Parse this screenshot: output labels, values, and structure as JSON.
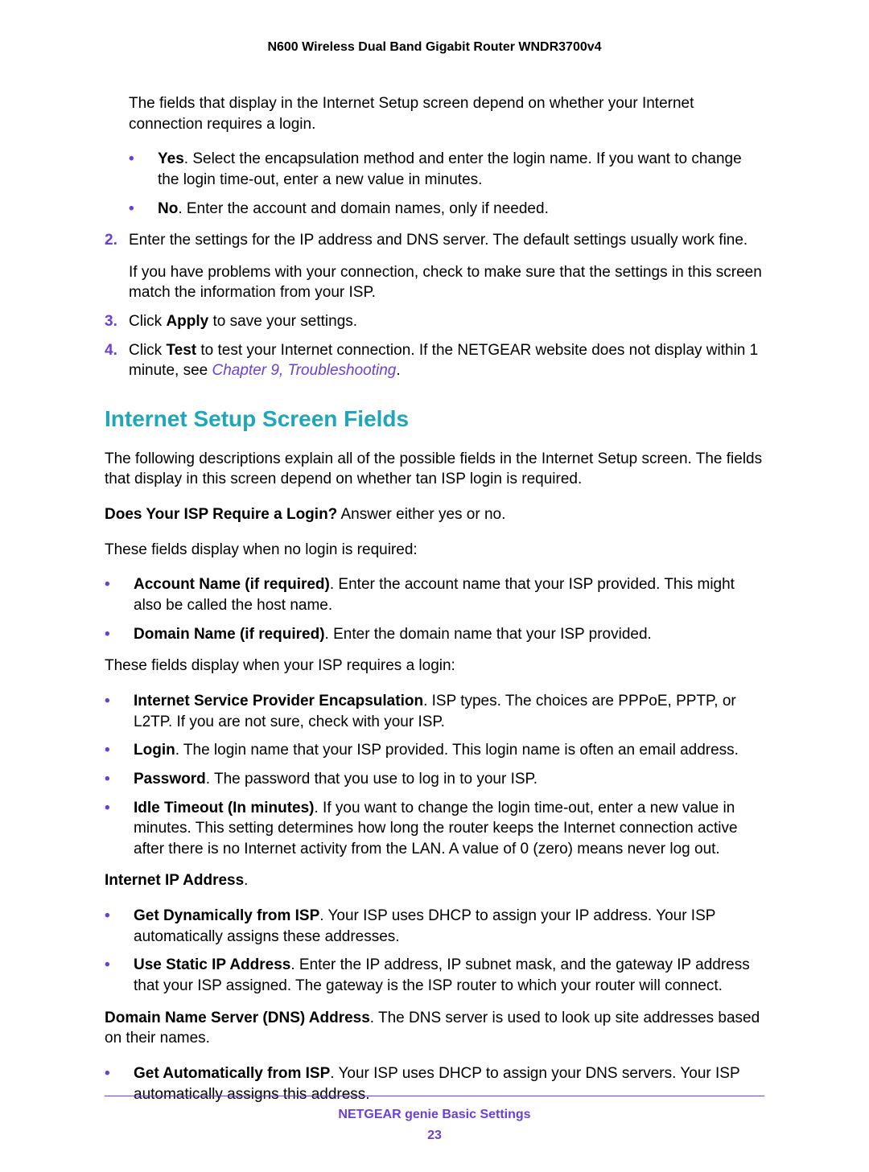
{
  "header": {
    "title": "N600 Wireless Dual Band Gigabit Router WNDR3700v4"
  },
  "intro_para": "The fields that display in the Internet Setup screen depend on whether your Internet connection requires a login.",
  "yes_no": {
    "yes_label": "Yes",
    "yes_text": ". Select the encapsulation method and enter the login name. If you want to change the login time-out, enter a new value in minutes.",
    "no_label": "No",
    "no_text": ". Enter the account and domain names, only if needed."
  },
  "steps": {
    "s2_num": "2.",
    "s2_text": "Enter the settings for the IP address and DNS server. The default settings usually work fine.",
    "s2_sub": "If you have problems with your connection, check to make sure that the settings in this screen match the information from your ISP.",
    "s3_num": "3.",
    "s3_pre": "Click ",
    "s3_bold": "Apply",
    "s3_post": " to save your settings.",
    "s4_num": "4.",
    "s4_pre": "Click ",
    "s4_bold": "Test",
    "s4_mid": " to test your Internet connection. If the NETGEAR website does not display within 1 minute, see ",
    "s4_link": "Chapter 9, Troubleshooting",
    "s4_post": "."
  },
  "section_heading": "Internet Setup Screen Fields",
  "section_intro": "The following descriptions explain all of the possible fields in the Internet Setup screen. The fields that display in this screen depend on whether tan ISP login is required.",
  "isp_login": {
    "q_bold": "Does Your ISP Require a Login?",
    "q_text": " Answer either yes or no."
  },
  "no_login_intro": "These fields display when no login is required:",
  "no_login_items": {
    "acct_bold": "Account Name (if required)",
    "acct_text": ". Enter the account name that your ISP provided. This might also be called the host name.",
    "domain_bold": "Domain Name (if required)",
    "domain_text": ". Enter the domain name that your ISP provided."
  },
  "login_intro": "These fields display when your ISP requires a login:",
  "login_items": {
    "encap_bold": "Internet Service Provider Encapsulation",
    "encap_text": ". ISP types. The choices are PPPoE, PPTP, or L2TP. If you are not sure, check with your ISP.",
    "login_bold": "Login",
    "login_text": ". The login name that your ISP provided. This login name is often an email address.",
    "pwd_bold": "Password",
    "pwd_text": ". The password that you use to log in to your ISP.",
    "idle_bold": "Idle Timeout (In minutes)",
    "idle_text": ". If you want to change the login time-out, enter a new value in minutes. This setting determines how long the router keeps the Internet connection active after there is no Internet activity from the LAN. A value of 0 (zero) means never log out."
  },
  "ip_heading": "Internet IP Address",
  "ip_heading_post": ".",
  "ip_items": {
    "dyn_bold": "Get Dynamically from ISP",
    "dyn_text": ". Your ISP uses DHCP to assign your IP address. Your ISP automatically assigns these addresses.",
    "static_bold": "Use Static IP Address",
    "static_text": ". Enter the IP address, IP subnet mask, and the gateway IP address that your ISP assigned. The gateway is the ISP router to which your router will connect."
  },
  "dns": {
    "head_bold": "Domain Name Server (DNS) Address",
    "head_text": ". The DNS server is used to look up site addresses based on their names.",
    "auto_bold": "Get Automatically from ISP",
    "auto_text": ". Your ISP uses DHCP to assign your DNS servers. Your ISP automatically assigns this address."
  },
  "footer": {
    "title": "NETGEAR genie Basic Settings",
    "page": "23"
  }
}
